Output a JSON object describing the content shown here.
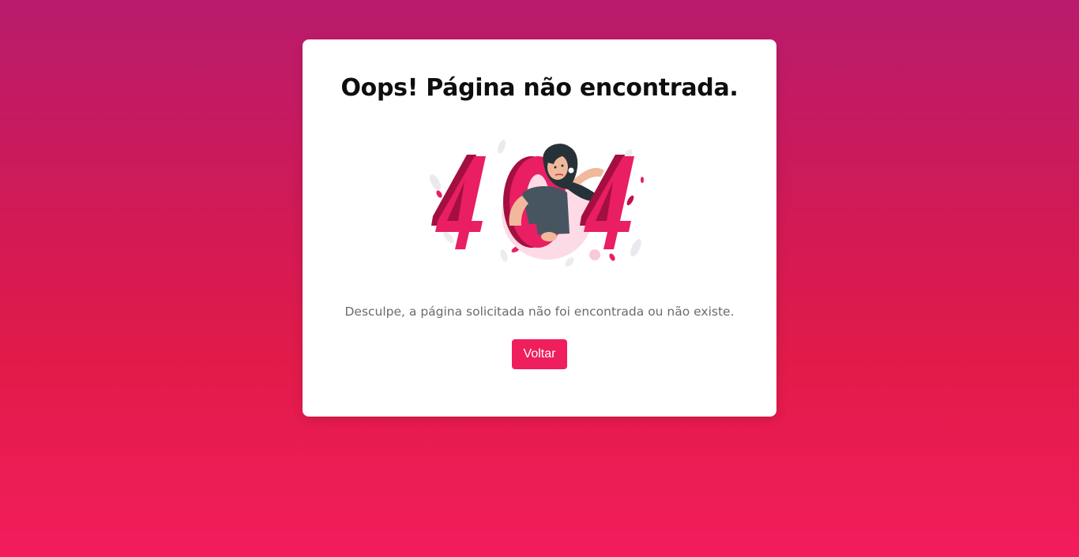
{
  "error_card": {
    "title": "Oops! Página não encontrada.",
    "illustration": {
      "icon": "404-woman-illustration-icon",
      "digits": "404"
    },
    "message": "Desculpe, a página solicitada não foi encontrada ou não existe.",
    "back_button_label": "Voltar"
  },
  "colors": {
    "accent": "#ee1f5c",
    "background_top": "#b91b6d",
    "background_bottom": "#f31c5c",
    "digit_face": "#e91e63",
    "digit_side": "#a3103f"
  }
}
